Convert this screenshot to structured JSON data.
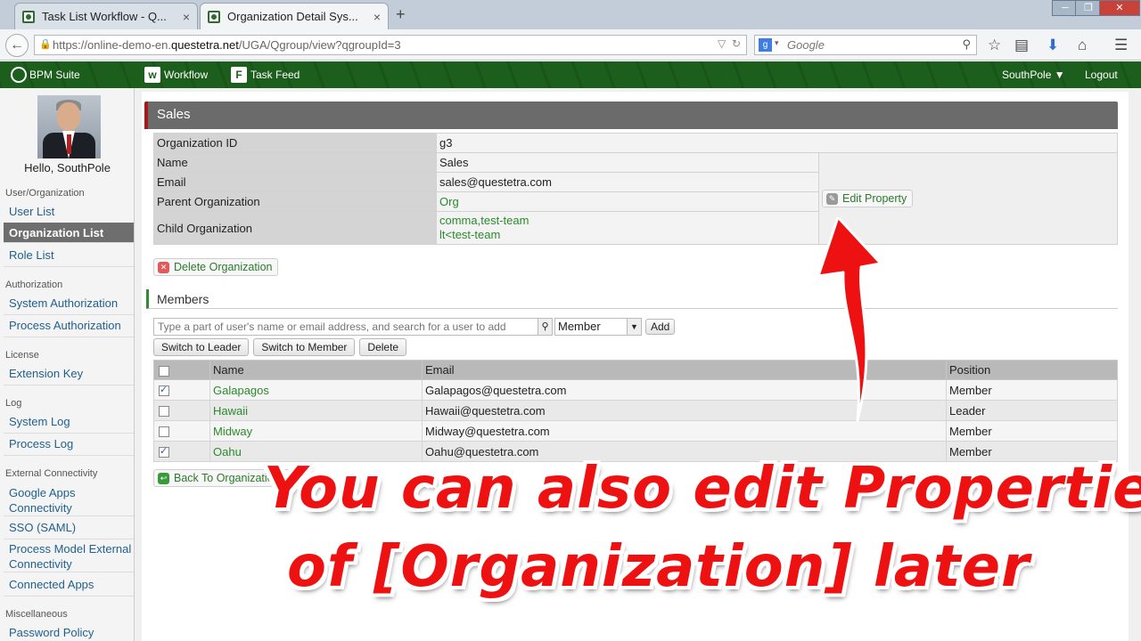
{
  "browser": {
    "tabs": [
      {
        "title": "Task List Workflow - Q...",
        "close": "×"
      },
      {
        "title": "Organization Detail Sys...",
        "close": "×"
      }
    ],
    "new_tab": "+",
    "url_scheme": "https://online-demo-en.",
    "url_domain": "questetra.net",
    "url_path": "/UGA/Qgroup/view?qgroupId=3",
    "search_placeholder": "Google",
    "search_engine": "g"
  },
  "header": {
    "brand": "BPM Suite",
    "nav": [
      {
        "icon": "w",
        "label": "Workflow"
      },
      {
        "icon": "F",
        "label": "Task Feed"
      }
    ],
    "user": "SouthPole ▼",
    "logout": "Logout"
  },
  "sidebar": {
    "greeting": "Hello, SouthPole",
    "sections": [
      {
        "title": "User/Organization",
        "items": [
          "User List",
          "Organization List",
          "Role List"
        ]
      },
      {
        "title": "Authorization",
        "items": [
          "System Authorization",
          "Process Authorization"
        ]
      },
      {
        "title": "License",
        "items": [
          "Extension Key"
        ]
      },
      {
        "title": "Log",
        "items": [
          "System Log",
          "Process Log"
        ]
      },
      {
        "title": "External Connectivity",
        "items": [
          "Google Apps Connectivity",
          "SSO (SAML)",
          "Process Model External Connectivity",
          "Connected Apps"
        ]
      },
      {
        "title": "Miscellaneous",
        "items": [
          "Password Policy"
        ]
      }
    ]
  },
  "org": {
    "title": "Sales",
    "labels": {
      "id": "Organization ID",
      "name": "Name",
      "email": "Email",
      "parent": "Parent Organization",
      "children": "Child Organization"
    },
    "values": {
      "id": "g3",
      "name": "Sales",
      "email": "sales@questetra.com",
      "parent": "Org",
      "children": [
        "comma,test-team",
        "lt<test-team"
      ]
    },
    "edit_property": "Edit Property",
    "delete_org": "Delete Organization"
  },
  "members": {
    "heading": "Members",
    "search_placeholder": "Type a part of user's name or email address, and search for a user to add",
    "position_select": "Member",
    "add": "Add",
    "switch_leader": "Switch to Leader",
    "switch_member": "Switch to Member",
    "delete": "Delete",
    "columns": [
      "Name",
      "Email",
      "Position"
    ],
    "rows": [
      {
        "name": "Galapagos",
        "email": "Galapagos@questetra.com",
        "position": "Member",
        "checked": true
      },
      {
        "name": "Hawaii",
        "email": "Hawaii@questetra.com",
        "position": "Leader",
        "checked": false
      },
      {
        "name": "Midway",
        "email": "Midway@questetra.com",
        "position": "Member",
        "checked": false
      },
      {
        "name": "Oahu",
        "email": "Oahu@questetra.com",
        "position": "Member",
        "checked": true
      }
    ],
    "back": "Back To Organization List"
  },
  "annotation": {
    "line1": "You can also edit Properties",
    "line2": "of [Organization] later",
    "color": "#ee1111"
  }
}
